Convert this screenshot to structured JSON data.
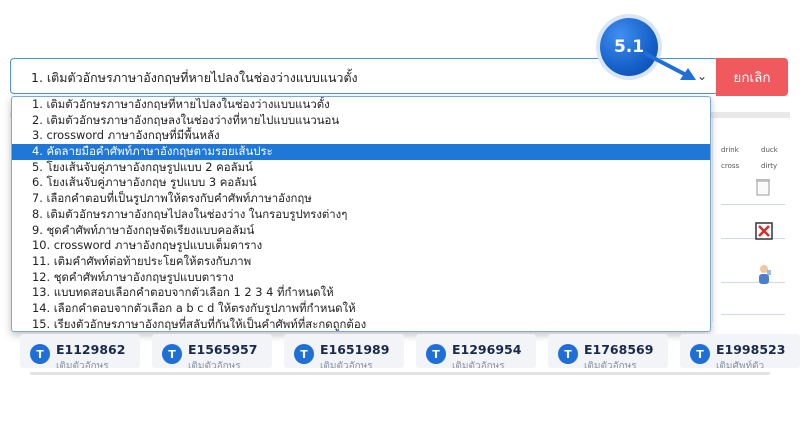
{
  "badge": "5.1",
  "select": {
    "value": "1. เติมตัวอักษรภาษาอังกฤษที่หายไปลงในช่องว่างแบบแนวตั้ง"
  },
  "cancel_label": "ยกเลิก",
  "options": [
    "1. เติมตัวอักษรภาษาอังกฤษที่หายไปลงในช่องว่างแบบแนวตั้ง",
    "2. เติมตัวอักษรภาษาอังกฤษลงในช่องว่างที่หายไปแบบแนวนอน",
    "3. crossword ภาษาอังกฤษที่มีพื้นหลัง",
    "4. คัดลายมือคำศัพท์ภาษาอังกฤษตามรอยเส้นประ",
    "5. โยงเส้นจับคู่ภาษาอังกฤษรูปแบบ 2 คอลัมน์",
    "6. โยงเส้นจับคู่ภาษาอังกฤษ รูปแบบ 3 คอลัมน์",
    "7. เลือกคำตอบที่เป็นรูปภาพให้ตรงกับคำศัพท์ภาษาอังกฤษ",
    "8. เติมตัวอักษรภาษาอังกฤษไปลงในช่องว่าง ในกรอบรูปทรงต่างๆ",
    "9. ชุดคำศัพท์ภาษาอังกฤษจัดเรียงแบบคอลัมน์",
    "10. crossword ภาษาอังกฤษรูปแบบเต็มตาราง",
    "11. เติมคำศัพท์ต่อท้ายประโยคให้ตรงกับภาพ",
    "12. ชุดคำศัพท์ภาษาอังกฤษรูปแบบตาราง",
    "13. แบบทดสอบเลือกคำตอบจากตัวเลือก 1 2 3 4 ที่กำหนดให้",
    "14. เลือกคำตอบจากตัวเลือก a b c d ให้ตรงกับรูปภาพที่กำหนดให้",
    "15. เรียงตัวอักษรภาษาอังกฤษที่สลับที่กันให้เป็นคำศัพท์ที่สะกดถูกต้อง"
  ],
  "selected_index": 3,
  "background_words": {
    "w1": "drink",
    "w2": "duck",
    "w3": "cross",
    "w4": "dirty"
  },
  "cards": [
    {
      "icon": "T",
      "code": "E1129862",
      "sub": "เติมตัวอักษร"
    },
    {
      "icon": "T",
      "code": "E1565957",
      "sub": "เติมตัวอักษร"
    },
    {
      "icon": "T",
      "code": "E1651989",
      "sub": "เติมตัวอักษร"
    },
    {
      "icon": "T",
      "code": "E1296954",
      "sub": "เติมตัวอักษร"
    },
    {
      "icon": "T",
      "code": "E1768569",
      "sub": "เติมตัวอักษร"
    },
    {
      "icon": "T",
      "code": "E1998523",
      "sub": "เติมศัพท์ตัว"
    }
  ],
  "colors": {
    "accent": "#1f78d8",
    "cancel": "#f05a5f",
    "border": "#4a90e2"
  }
}
